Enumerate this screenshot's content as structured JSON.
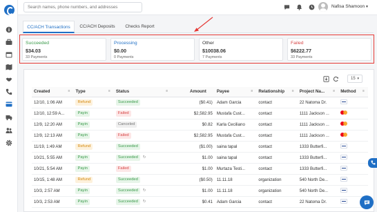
{
  "colors": {
    "accent": "#1f6fc5",
    "success": "#3a9a4a",
    "processing": "#1f6fc5",
    "other": "#333333",
    "failed": "#d64545",
    "highlight": "#e53935"
  },
  "search": {
    "placeholder": "Search names, phone numbers, and addresses"
  },
  "user": {
    "name": "Nafisa Shamoon"
  },
  "tabs": [
    {
      "label": "CC/ACH Transactions",
      "active": true
    },
    {
      "label": "CC/ACH Deposits",
      "active": false
    },
    {
      "label": "Checks Report",
      "active": false
    }
  ],
  "summary": [
    {
      "label": "Succeeded",
      "amount": "$34.03",
      "count": "33 Payments",
      "color": "#3a9a4a"
    },
    {
      "label": "Processing",
      "amount": "$0.00",
      "count": "0 Payments",
      "color": "#1f6fc5"
    },
    {
      "label": "Other",
      "amount": "$10038.06",
      "count": "7 Payments",
      "color": "#333333"
    },
    {
      "label": "Failed",
      "amount": "$6222.77",
      "count": "33 Payments",
      "color": "#d64545"
    }
  ],
  "table": {
    "page_size": "15",
    "headers": [
      "Created",
      "Type",
      "Status",
      "Amount",
      "Payee",
      "Relationship",
      "Project Na...",
      "Method"
    ],
    "rows": [
      {
        "created": "12/10, 1:06 AM",
        "type": "Refund",
        "status": "Succeeded",
        "status_icon": false,
        "amount": "($0.41)",
        "payee": "Adam Garcia",
        "relationship": "contact",
        "project": "22 Natoma Dr.",
        "method": "visa"
      },
      {
        "created": "12/10, 12:59 A...",
        "type": "Payin",
        "status": "Failed",
        "status_icon": false,
        "amount": "$2,582.95",
        "payee": "Mustafa Cust...",
        "relationship": "contact",
        "project": "1111 Jackson ...",
        "method": "mastercard"
      },
      {
        "created": "12/9, 12:20 AM",
        "type": "Payin",
        "status": "Canceled",
        "status_icon": false,
        "amount": "$0.82",
        "payee": "Karla Ceciliano",
        "relationship": "contact",
        "project": "1111 Jackson ...",
        "method": "mastercard"
      },
      {
        "created": "12/9, 12:13 AM",
        "type": "Payin",
        "status": "Failed",
        "status_icon": false,
        "amount": "$2,582.95",
        "payee": "Mustafa Cust...",
        "relationship": "contact",
        "project": "1111 Jackson ...",
        "method": "mastercard"
      },
      {
        "created": "11/19, 1:49 AM",
        "type": "Refund",
        "status": "Succeeded",
        "status_icon": false,
        "amount": "($1.00)",
        "payee": "saina tapal",
        "relationship": "contact",
        "project": "1333 Butterfi...",
        "method": "visa"
      },
      {
        "created": "10/21, 5:55 AM",
        "type": "Payin",
        "status": "Succeeded",
        "status_icon": true,
        "amount": "$1.00",
        "payee": "saina tapal",
        "relationship": "contact",
        "project": "1333 Butterfi...",
        "method": "visa"
      },
      {
        "created": "10/21, 5:54 AM",
        "type": "Payin",
        "status": "Failed",
        "status_icon": false,
        "amount": "$1.00",
        "payee": "Murtaza Testi...",
        "relationship": "contact",
        "project": "1333 Butterfi...",
        "method": "visa"
      },
      {
        "created": "10/15, 1:48 AM",
        "type": "Refund",
        "status": "Succeeded",
        "status_icon": false,
        "amount": "($0.50)",
        "payee": "11.11.18",
        "relationship": "organization",
        "project": "540 North De...",
        "method": "visa"
      },
      {
        "created": "10/3, 2:57 AM",
        "type": "Payin",
        "status": "Succeeded",
        "status_icon": true,
        "amount": "$1.00",
        "payee": "11.11.18",
        "relationship": "organization",
        "project": "540 North De...",
        "method": "visa"
      },
      {
        "created": "10/3, 2:53 AM",
        "type": "Payin",
        "status": "Succeeded",
        "status_icon": true,
        "amount": "$0.41",
        "payee": "Adam Garcia",
        "relationship": "contact",
        "project": "22 Natoma Dr.",
        "method": "visa"
      }
    ]
  }
}
